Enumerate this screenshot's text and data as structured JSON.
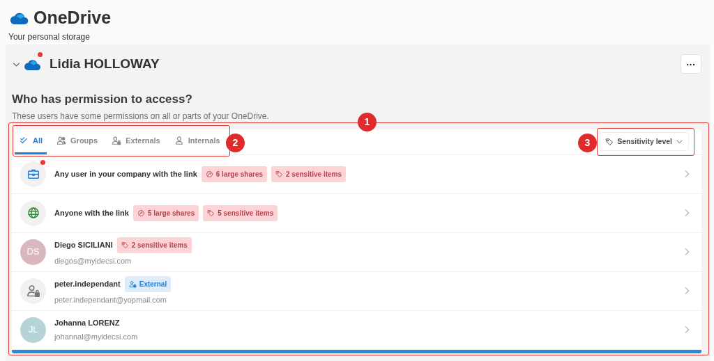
{
  "app": {
    "title": "OneDrive",
    "subtitle": "Your personal storage"
  },
  "account": {
    "name": "Lidia HOLLOWAY",
    "expanded": true,
    "notification": true,
    "menu_button": "···"
  },
  "section": {
    "heading": "Who has permission to access?",
    "description": "These users have some permissions on all or parts of your OneDrive."
  },
  "tabs": [
    {
      "label": "All",
      "selected": true
    },
    {
      "label": "Groups",
      "selected": false
    },
    {
      "label": "Externals",
      "selected": false
    },
    {
      "label": "Internals",
      "selected": false
    }
  ],
  "filter": {
    "label": "Sensitivity level"
  },
  "entries": [
    {
      "kind": "company-link",
      "notification": true,
      "name": "Any user in your company with the link",
      "tags": [
        {
          "kind": "shares",
          "label": "6 large shares"
        },
        {
          "kind": "sensitive",
          "label": "2 sensitive items"
        }
      ]
    },
    {
      "kind": "public-link",
      "notification": false,
      "name": "Anyone with the link",
      "tags": [
        {
          "kind": "shares",
          "label": "5 large shares"
        },
        {
          "kind": "sensitive",
          "label": "5 sensitive items"
        }
      ]
    },
    {
      "kind": "avatar",
      "initials": "DS",
      "color": "#d9b8bd",
      "name": "Diego SICILIANI",
      "email": "diegos@myidecsi.com",
      "tags": [
        {
          "kind": "sensitive",
          "label": "2 sensitive items"
        }
      ]
    },
    {
      "kind": "external",
      "notification": false,
      "name": "peter.independant",
      "email": "peter.independant@yopmail.com",
      "tags": [
        {
          "kind": "external",
          "label": "External"
        }
      ]
    },
    {
      "kind": "avatar",
      "initials": "JL",
      "color": "#b7d3da",
      "name": "Johanna LORENZ",
      "email": "johannal@myidecsi.com"
    }
  ],
  "progress": {
    "level": 1
  },
  "annotations": [
    {
      "number": "1"
    },
    {
      "number": "2"
    },
    {
      "number": "3"
    }
  ]
}
